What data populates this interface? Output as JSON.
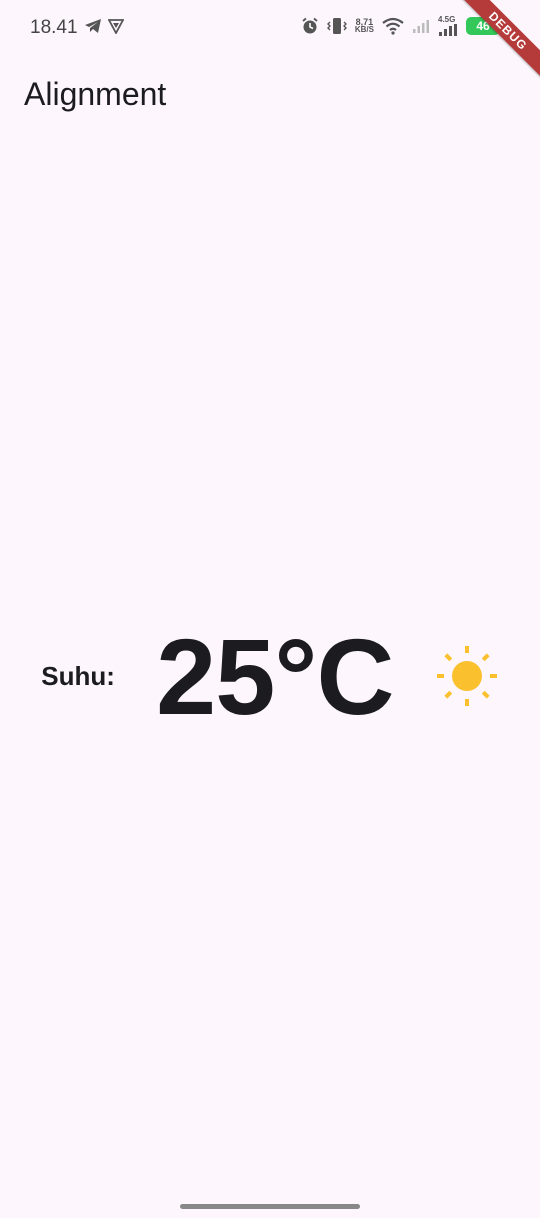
{
  "status_bar": {
    "time": "18.41",
    "net_speed_value": "8,71",
    "net_speed_unit": "KB/S",
    "network_type": "4.5G",
    "battery": "46"
  },
  "debug_banner": "DEBUG",
  "app_bar": {
    "title": "Alignment"
  },
  "content": {
    "label": "Suhu:",
    "temperature": "25°C",
    "weather_icon": "sun-icon"
  },
  "colors": {
    "background": "#fdf7fd",
    "text": "#1c1b1f",
    "sun": "#fbc02d",
    "battery": "#34c759",
    "debug": "#b53a3a"
  }
}
